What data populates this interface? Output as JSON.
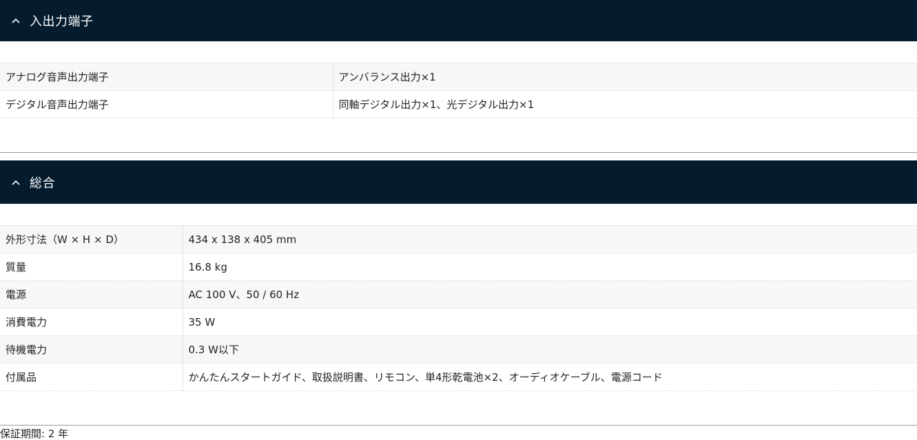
{
  "sections": [
    {
      "title": "入出力端子",
      "rows": [
        {
          "key": "アナログ音声出力端子",
          "value": "アンバランス出力×1"
        },
        {
          "key": "デジタル音声出力端子",
          "value": "同軸デジタル出力×1、光デジタル出力×1"
        }
      ]
    },
    {
      "title": "総合",
      "rows": [
        {
          "key": "外形寸法（W × H × D）",
          "value": "434 x 138 x 405 mm"
        },
        {
          "key": "質量",
          "value": "16.8 kg"
        },
        {
          "key": "電源",
          "value": "AC 100 V、50 / 60 Hz"
        },
        {
          "key": "消費電力",
          "value": "35 W"
        },
        {
          "key": "待機電力",
          "value": "0.3 W以下"
        },
        {
          "key": "付属品",
          "value": "かんたんスタートガイド、取扱説明書、リモコン、単4形乾電池×2、オーディオケーブル、電源コード"
        }
      ]
    }
  ],
  "warranty": "保証期間: 2 年",
  "icons": {
    "collapse": "chevron-up-icon"
  },
  "colors": {
    "header_bg": "#041c2e",
    "header_text": "#ffffff",
    "row_alt": "#f7f7f7"
  }
}
